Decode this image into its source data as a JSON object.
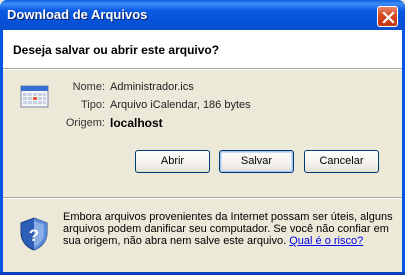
{
  "window": {
    "title": "Download de Arquivos"
  },
  "dialog": {
    "question": "Deseja salvar ou abrir este arquivo?",
    "file": {
      "name_label": "Nome:",
      "name_value": "Administrador.ics",
      "type_label": "Tipo:",
      "type_value": "Arquivo iCalendar, 186 bytes",
      "origin_label": "Origem:",
      "origin_value": "localhost"
    },
    "buttons": {
      "open": "Abrir",
      "save": "Salvar",
      "cancel": "Cancelar"
    },
    "warning": {
      "text": "Embora arquivos provenientes da Internet possam ser úteis, alguns arquivos podem danificar seu computador. Se você não confiar em sua origem, não abra nem salve este arquivo.",
      "link": "Qual é o risco?"
    }
  },
  "icons": {
    "file": "calendar-file-icon",
    "warning": "security-shield-icon",
    "close": "close-icon"
  },
  "colors": {
    "titlebar": "#0055e5",
    "close_button": "#d8491f",
    "dialog_background": "#ece9d8",
    "link": "#0000ee"
  }
}
